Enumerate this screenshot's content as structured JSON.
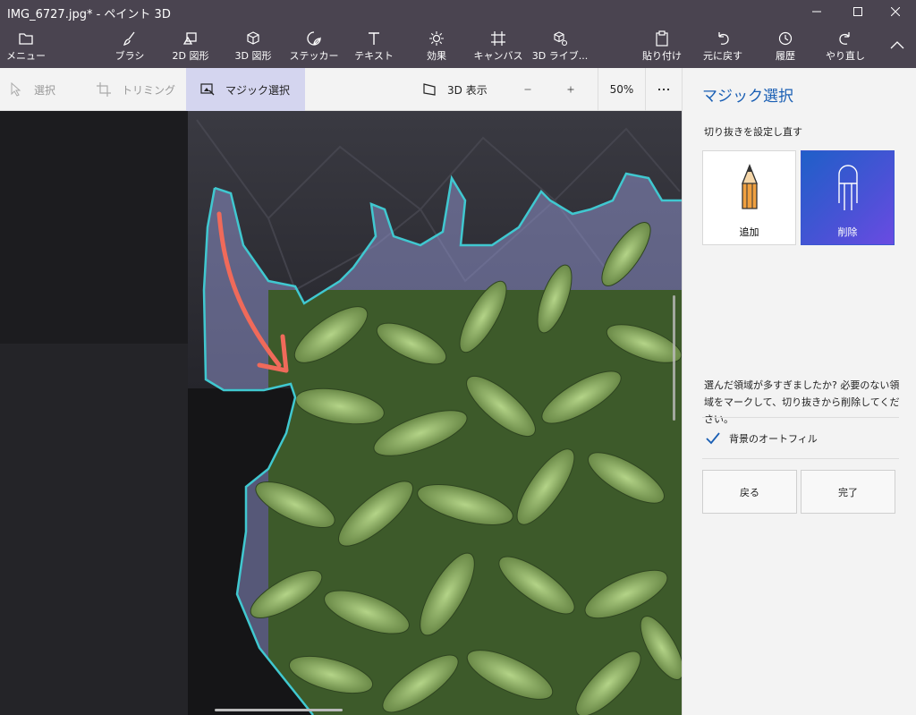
{
  "window": {
    "title": "IMG_6727.jpg* - ペイント 3D"
  },
  "ribbon": {
    "menu": "メニュー",
    "brush": "ブラシ",
    "shapes2d": "2D 図形",
    "shapes3d": "3D 図形",
    "stickers": "ステッカー",
    "text": "テキスト",
    "effects": "効果",
    "canvas": "キャンバス",
    "library3d": "3D ライブ...",
    "paste": "貼り付け",
    "undo": "元に戻す",
    "history": "履歴",
    "redo": "やり直し"
  },
  "subbar": {
    "select": "選択",
    "crop": "トリミング",
    "magic_select": "マジック選択",
    "view3d": "3D 表示",
    "zoom": "50%"
  },
  "panel": {
    "title": "マジック選択",
    "subtitle": "切り抜きを設定し直す",
    "add_label": "追加",
    "remove_label": "削除",
    "description": "選んだ領域が多すぎましたか? 必要のない領域をマークして、切り抜きから削除してください。",
    "autofill_label": "背景のオートフィル",
    "autofill_checked": true,
    "back_label": "戻る",
    "done_label": "完了"
  },
  "colors": {
    "ribbon_bg": "#4a4450",
    "accent": "#1a5fb4",
    "selected_card": "#3b57d0",
    "selection_outline": "#40c8d0",
    "arrow": "#f06a5a"
  }
}
